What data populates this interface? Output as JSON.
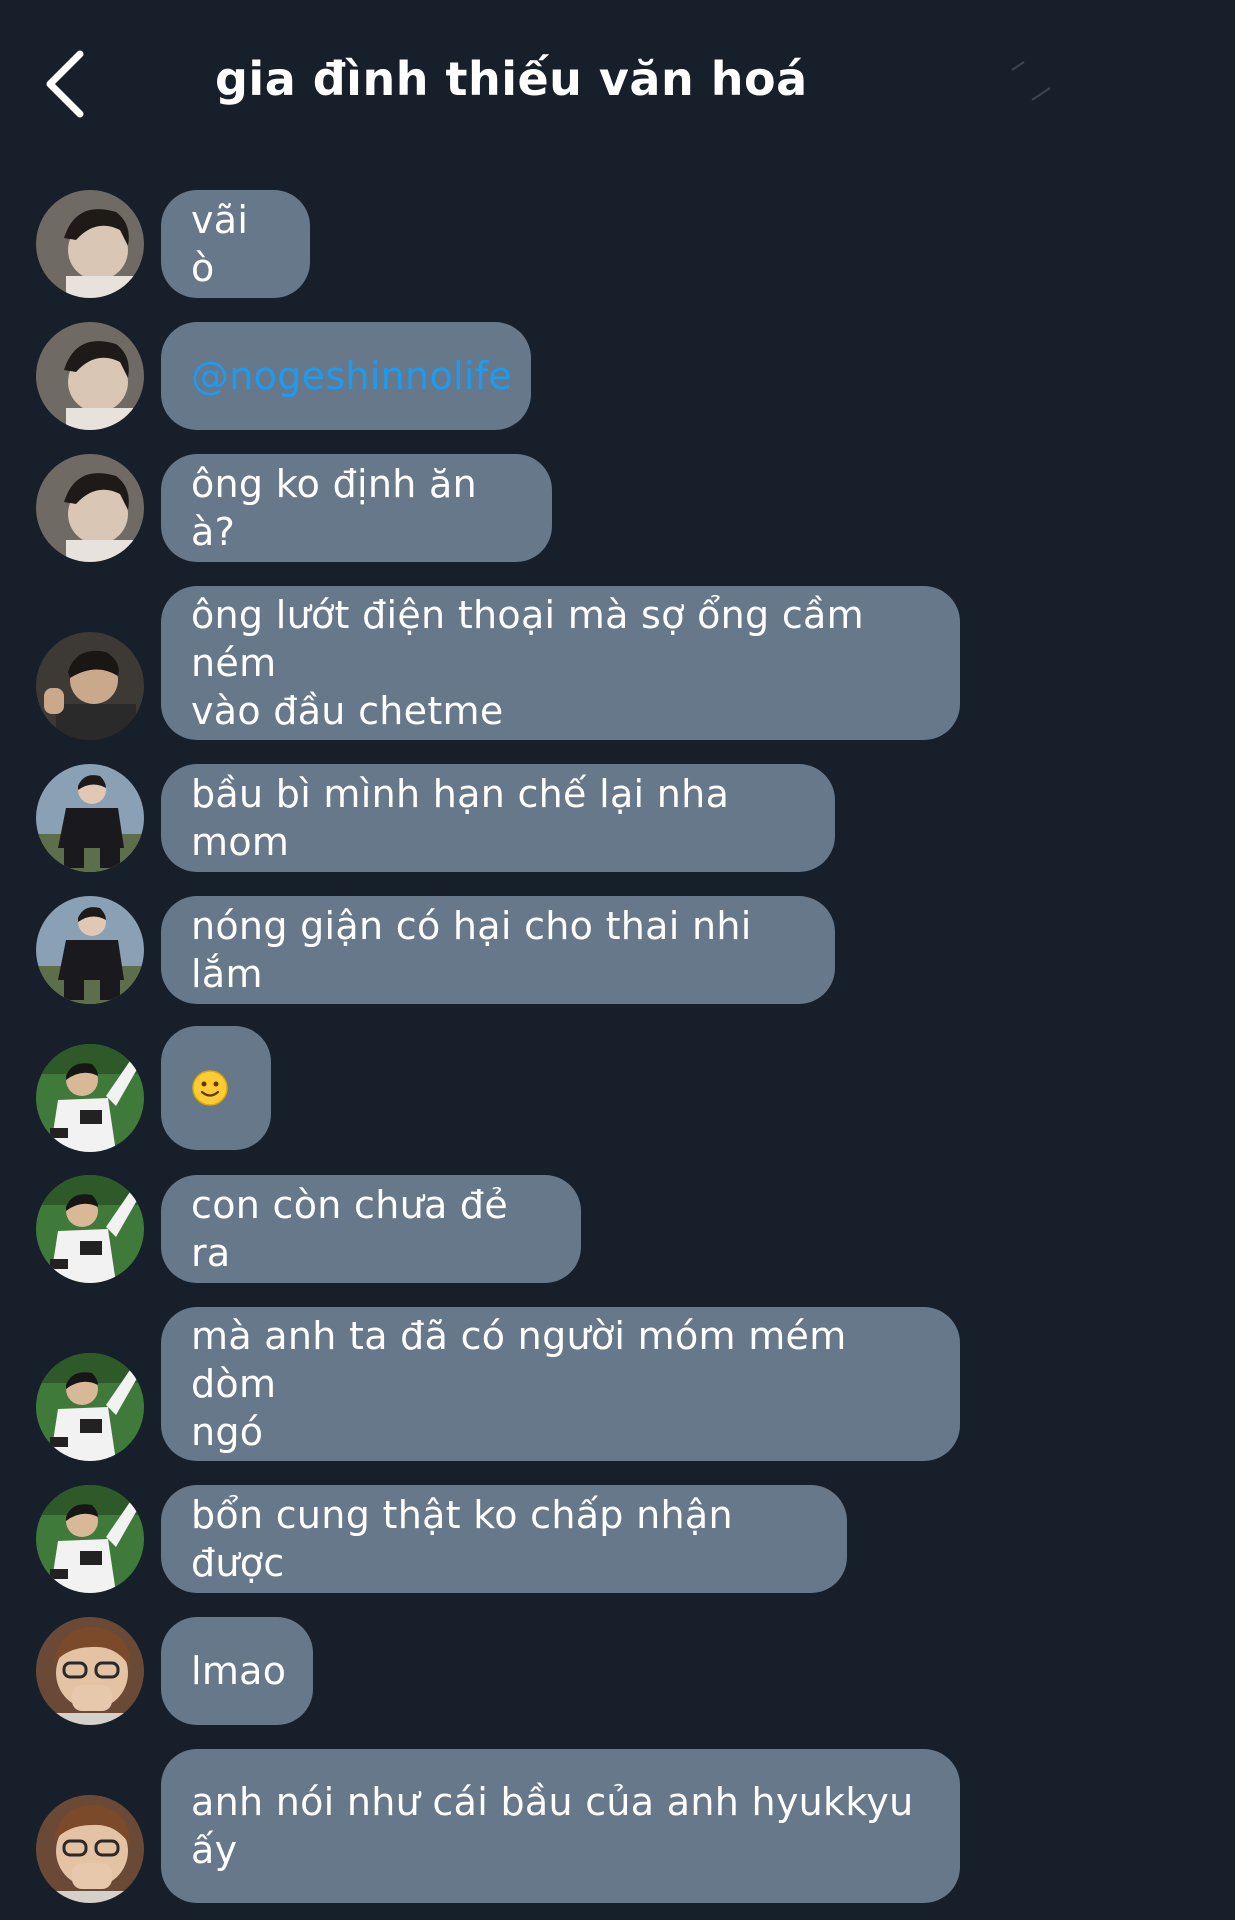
{
  "header": {
    "title": "gia đình thiếu văn hoá"
  },
  "colors": {
    "background": "#171f2a",
    "bubble": "#66788a",
    "mention": "#1d9bf0"
  },
  "messages": [
    {
      "text": "vãi ò",
      "avatar": "user-a-avatar"
    },
    {
      "text": "@nogeshinnolife",
      "avatar": "user-a-avatar",
      "type": "mention"
    },
    {
      "text": "ông ko định ăn à?",
      "avatar": "user-a-avatar"
    },
    {
      "text": "ông lướt điện thoại mà sợ ổng cầm ném\nvào đầu chetme",
      "avatar": "user-b-avatar"
    },
    {
      "text": "bầu bì mình hạn chế lại nha mom",
      "avatar": "user-c-avatar"
    },
    {
      "text": "nóng giận có hại cho thai nhi lắm",
      "avatar": "user-c-avatar"
    },
    {
      "text": "",
      "avatar": "user-d-avatar",
      "type": "emoji",
      "emoji": "slightly-smiling-face-icon"
    },
    {
      "text": "con còn chưa đẻ ra",
      "avatar": "user-d-avatar"
    },
    {
      "text": "mà anh ta đã có người móm mém dòm\nngó",
      "avatar": "user-d-avatar"
    },
    {
      "text": "bổn cung thật ko chấp nhận được",
      "avatar": "user-d-avatar"
    },
    {
      "text": "lmao",
      "avatar": "user-e-avatar"
    },
    {
      "text": "anh nói như cái bầu của anh hyukkyu\nấy",
      "avatar": "user-e-avatar"
    }
  ]
}
